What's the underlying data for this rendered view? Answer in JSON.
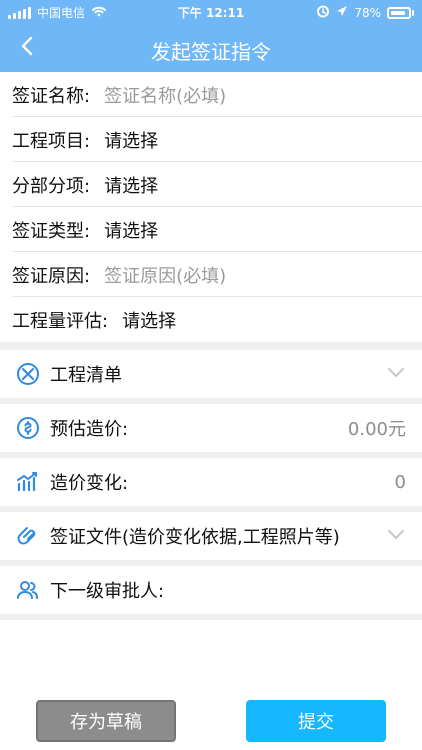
{
  "status_bar": {
    "carrier": "中国电信",
    "time": "下午 12:11",
    "battery": "78%"
  },
  "nav": {
    "title": "发起签证指令"
  },
  "form": {
    "rows": [
      {
        "label": "签证名称:",
        "placeholder": "签证名称(必填)"
      },
      {
        "label": "工程项目:",
        "value": "请选择"
      },
      {
        "label": "分部分项:",
        "value": "请选择"
      },
      {
        "label": "签证类型:",
        "value": "请选择"
      },
      {
        "label": "签证原因:",
        "placeholder": "签证原因(必填)"
      },
      {
        "label": "工程量评估:",
        "value": "请选择"
      }
    ]
  },
  "sections": {
    "project_list": {
      "label": "工程清单"
    },
    "estimated_price": {
      "label": "预估造价:",
      "value": "0.00元"
    },
    "price_change": {
      "label": "造价变化:",
      "value": "0"
    },
    "files": {
      "label": "签证文件(造价变化依据,工程照片等)"
    },
    "next_approver": {
      "label": "下一级审批人:"
    }
  },
  "footer": {
    "draft_label": "存为草稿",
    "submit_label": "提交"
  },
  "colors": {
    "header": "#6fb7f6",
    "submit": "#15b7ff",
    "draft": "#8c8c8c",
    "icon": "#2f8be0",
    "placeholder": "#9a9a9a"
  },
  "icons": {
    "back": "chevron-left-icon",
    "project_list": "crossed-tools-icon",
    "estimated_price": "coin-icon",
    "price_change": "trend-chart-icon",
    "files": "paperclip-icon",
    "next_approver": "users-icon",
    "expand": "chevron-down-icon"
  }
}
